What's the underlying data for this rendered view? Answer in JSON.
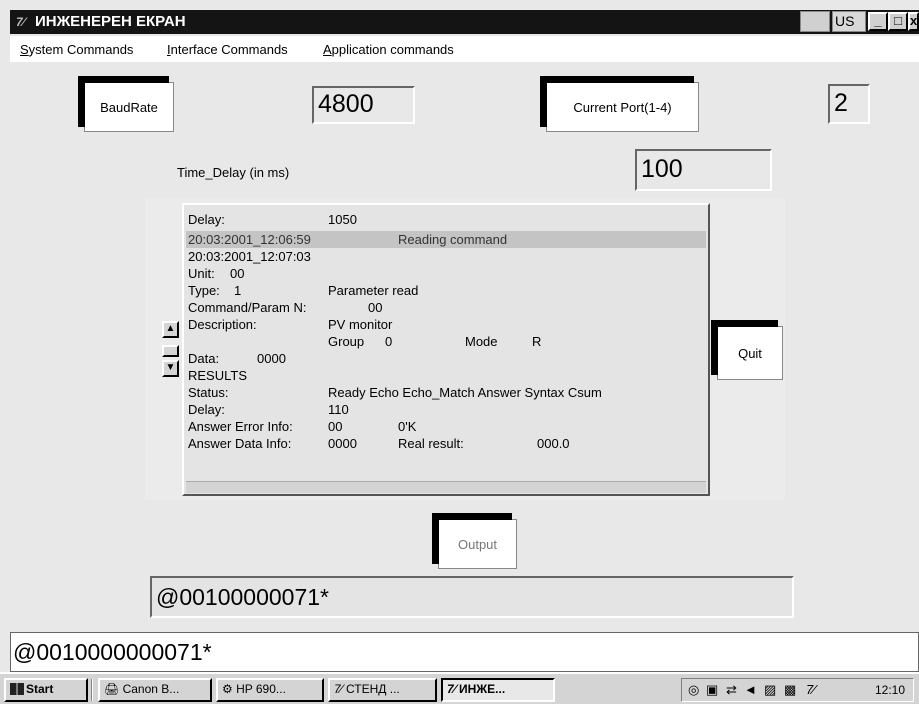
{
  "window": {
    "title": "ИНЖЕНЕРЕН ЕКРАН",
    "app_icon": "7⁄",
    "language": "US",
    "controls": {
      "minimize": "_",
      "maximize": "□",
      "close": "x"
    }
  },
  "menu": {
    "items": [
      "System Commands",
      "Interface Commands",
      "Application commands"
    ]
  },
  "controls": {
    "baudrate_button": "BaudRate",
    "baudrate_value": "4800",
    "current_port_button": "Current Port(1-4)",
    "current_port_value": "2",
    "time_delay_label": "Time_Delay (in ms)",
    "time_delay_value": "100",
    "quit_button": "Quit",
    "output_button": "Output",
    "output_value": "@00100000071*"
  },
  "info": {
    "delay_label": "Delay:",
    "delay_value": "1050",
    "timestamp1": "20:03:2001_12:06:59",
    "timestamp1_msg": "Reading command",
    "timestamp2": "20:03:2001_12:07:03",
    "unit_label": "Unit:",
    "unit_value": "00",
    "type_label": "Type:",
    "type_value": "1",
    "type_desc": "Parameter read",
    "command_label": "Command/Param N:",
    "command_value": "00",
    "description_label": "Description:",
    "description_value": "PV monitor",
    "group_label": "Group",
    "group_value": "0",
    "mode_label": "Mode",
    "mode_value": "R",
    "data_label": "Data:",
    "data_value": "0000",
    "results_label": "RESULTS",
    "status_label": "Status:",
    "status_value": "Ready Echo Echo_Match Answer Syntax Csum",
    "delay2_label": "Delay:",
    "delay2_value": "110",
    "answer_error_label": "Answer Error Info:",
    "answer_error_value": "00",
    "answer_error_msg": "0'K",
    "answer_data_label": "Answer Data  Info:",
    "answer_data_value": "0000",
    "real_result_label": "Real result:",
    "real_result_value": "000.0"
  },
  "status_line": "@0010000000071*",
  "taskbar": {
    "start": "Start",
    "items": [
      "Canon B...",
      "HP 690...",
      "СТЕНД ...",
      "ИНЖЕ..."
    ],
    "clock": "12:10"
  }
}
